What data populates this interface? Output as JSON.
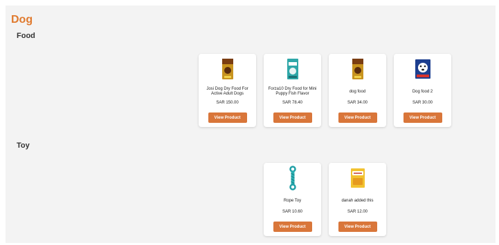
{
  "page": {
    "title": "Dog"
  },
  "colors": {
    "accent": "#e07a2e",
    "button": "#d9763a"
  },
  "sections": [
    {
      "title": "Food",
      "products": [
        {
          "name": "Josi Dog Dry Food For Active Adult Dogs",
          "price": "SAR 150.00",
          "button": "View Product",
          "icon": "dog-food-bag-icon"
        },
        {
          "name": "Forza10 Dry Food for Mini Puppy Fish Flavor",
          "price": "SAR 78.40",
          "button": "View Product",
          "icon": "dog-food-bag-icon"
        },
        {
          "name": "dog food",
          "price": "SAR 34.00",
          "button": "View Product",
          "icon": "dog-food-bag-icon"
        },
        {
          "name": "Dog food 2",
          "price": "SAR 30.00",
          "button": "View Product",
          "icon": "dog-food-bag-icon"
        }
      ]
    },
    {
      "title": "Toy",
      "products": [
        {
          "name": "Rope Toy",
          "price": "SAR 10.60",
          "button": "View Product",
          "icon": "rope-toy-icon"
        },
        {
          "name": "danah added this",
          "price": "SAR 12.00",
          "button": "View Product",
          "icon": "treat-pack-icon"
        }
      ]
    }
  ]
}
